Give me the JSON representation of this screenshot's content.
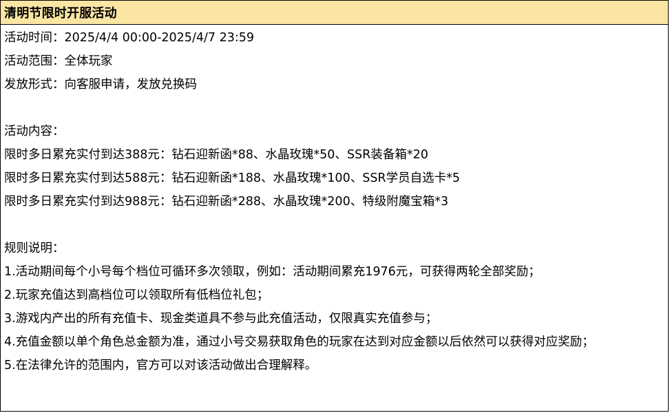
{
  "title": "清明节限时开服活动",
  "info": {
    "time": "活动时间：2025/4/4 00:00-2025/4/7 23:59",
    "scope": "活动范围：全体玩家",
    "method": "发放形式：向客服申请，发放兑换码"
  },
  "content": {
    "heading": "活动内容：",
    "tiers": [
      "限时多日累充实付到达388元：钻石迎新函*88、水晶玫瑰*50、SSR装备箱*20",
      "限时多日累充实付到达588元：钻石迎新函*188、水晶玫瑰*100、SSR学员自选卡*5",
      "限时多日累充实付到达988元：钻石迎新函*288、水晶玫瑰*200、特级附魔宝箱*3"
    ]
  },
  "rules": {
    "heading": "规则说明：",
    "items": [
      "1.活动期间每个小号每个档位可循环多次领取，例如：活动期间累充1976元，可获得两轮全部奖励；",
      "2.玩家充值达到高档位可以领取所有低档位礼包；",
      "3.游戏内产出的所有充值卡、现金类道具不参与此充值活动，仅限真实充值参与；",
      "4.充值金额以单个角色总金额为准，通过小号交易获取角色的玩家在达到对应金额以后依然可以获得对应奖励；",
      "5.在法律允许的范围内，官方可以对该活动做出合理解释。"
    ]
  },
  "colors": {
    "title_background": "#fbe5a3",
    "border": "#000000"
  }
}
